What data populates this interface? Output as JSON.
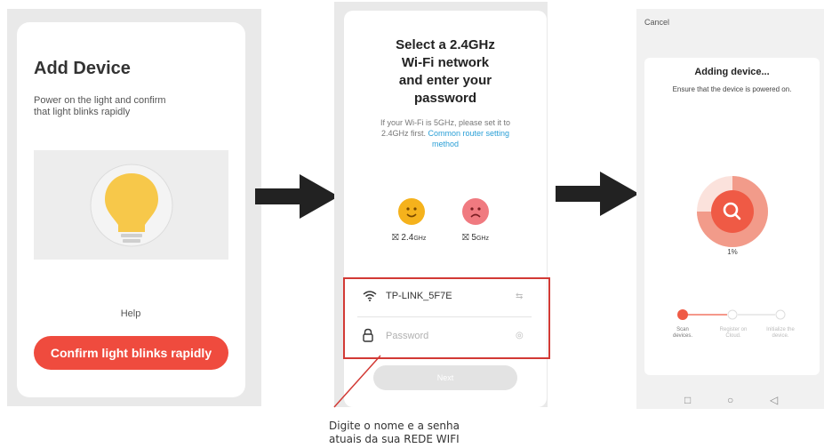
{
  "screen1": {
    "title": "Add Device",
    "desc_line1": "Power on the light and confirm",
    "desc_line2": "that light blinks  rapidly",
    "help": "Help",
    "confirm_button": "Confirm light blinks rapidly",
    "bulb_color": "#f7c84a"
  },
  "screen2": {
    "title_line1": "Select a 2.4GHz",
    "title_line2": "Wi-Fi network",
    "title_line3": "and enter your",
    "title_line4": "password",
    "note_line1": "If your Wi-Fi is 5GHz, please set it to",
    "note_line2_plain": "2.4GHz first. ",
    "note_link_part1": "Common router setting",
    "note_link_part2": "method",
    "band_ok_main": "2.4",
    "band_ok_unit": "GHz",
    "band_bad_main": "5",
    "band_bad_unit": "GHz",
    "wifi_name": "TP-LINK_5F7E",
    "password_placeholder": "Password",
    "next_button": "Next"
  },
  "caption": {
    "line1": "Digite o nome e a senha",
    "line2": "atuais da sua REDE WIFI"
  },
  "screen3": {
    "cancel": "Cancel",
    "title": "Adding device...",
    "subtitle": "Ensure that the device is powered on.",
    "progress_label": "1%",
    "progress_value": 0.01,
    "steps": [
      {
        "line1": "Scan",
        "line2": "devices."
      },
      {
        "line1": "Register on",
        "line2": "Cloud."
      },
      {
        "line1": "Initialize the",
        "line2": "device."
      }
    ],
    "accent": "#ef5a45"
  }
}
